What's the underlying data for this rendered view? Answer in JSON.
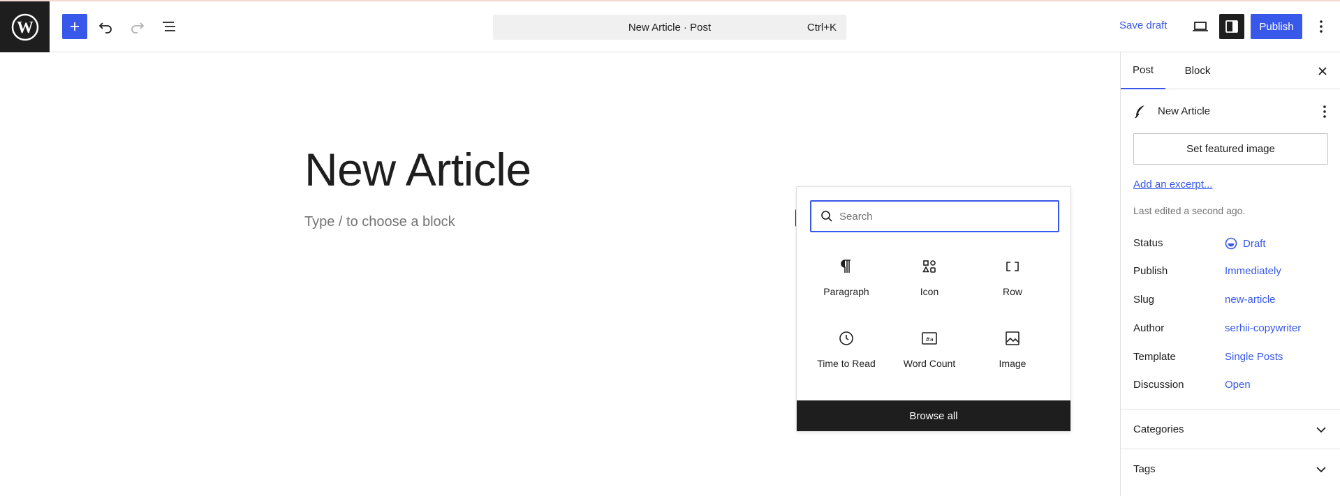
{
  "toolbar": {
    "command_title": "New Article · Post",
    "command_shortcut": "Ctrl+K",
    "save_draft_label": "Save draft",
    "publish_label": "Publish",
    "accent_color": "#3858e9"
  },
  "editor": {
    "post_title": "New Article",
    "block_placeholder": "Type / to choose a block"
  },
  "inserter": {
    "search_placeholder": "Search",
    "blocks": [
      {
        "label": "Paragraph",
        "icon": "paragraph-icon"
      },
      {
        "label": "Icon",
        "icon": "shapes-icon"
      },
      {
        "label": "Row",
        "icon": "row-icon"
      },
      {
        "label": "Time to Read",
        "icon": "clock-icon"
      },
      {
        "label": "Word Count",
        "icon": "word-count-icon"
      },
      {
        "label": "Image",
        "icon": "image-icon"
      }
    ],
    "browse_all_label": "Browse all"
  },
  "sidebar": {
    "tabs": [
      {
        "label": "Post",
        "active": true
      },
      {
        "label": "Block",
        "active": false
      }
    ],
    "post_title": "New Article",
    "featured_image_label": "Set featured image",
    "excerpt_link": "Add an excerpt...",
    "last_edited": "Last edited a second ago.",
    "meta": [
      {
        "label": "Status",
        "value": "Draft"
      },
      {
        "label": "Publish",
        "value": "Immediately"
      },
      {
        "label": "Slug",
        "value": "new-article"
      },
      {
        "label": "Author",
        "value": "serhii-copywriter"
      },
      {
        "label": "Template",
        "value": "Single Posts"
      },
      {
        "label": "Discussion",
        "value": "Open"
      }
    ],
    "sections": [
      {
        "label": "Categories"
      },
      {
        "label": "Tags"
      }
    ]
  }
}
